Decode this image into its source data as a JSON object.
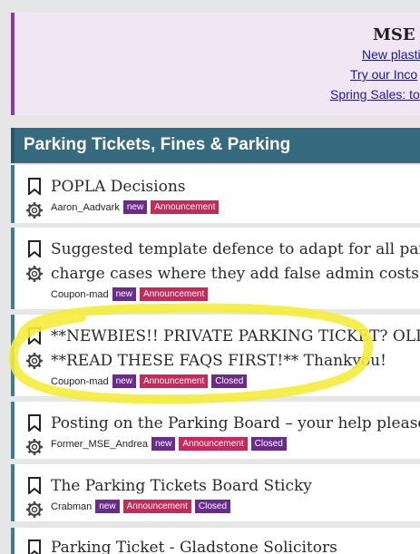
{
  "banner": {
    "title": "MSE H",
    "links": [
      "New plastic #",
      "Try our Inco",
      "Spring Sales: to"
    ]
  },
  "board": {
    "title": "Parking Tickets, Fines & Parking"
  },
  "threads": [
    {
      "title_lines": [
        "POPLA Decisions"
      ],
      "author": "Aaron_Aadvark",
      "badges": [
        "new",
        "Announcement"
      ]
    },
    {
      "title_lines": [
        "Suggested template defence to adapt for all parki",
        "charge cases where they add false admin costs"
      ],
      "author": "Coupon-mad",
      "badges": [
        "new",
        "Announcement"
      ]
    },
    {
      "title_lines": [
        "**NEWBIES!! PRIVATE PARKING TICKET? OLD C",
        "**READ THESE FAQS FIRST!** Thankyou!"
      ],
      "author": "Coupon-mad",
      "badges": [
        "new",
        "Announcement",
        "Closed"
      ]
    },
    {
      "title_lines": [
        "Posting on the Parking Board – your help please"
      ],
      "author": "Former_MSE_Andrea",
      "badges": [
        "new",
        "Announcement",
        "Closed"
      ]
    },
    {
      "title_lines": [
        "The Parking Tickets Board Sticky"
      ],
      "author": "Crabman",
      "badges": [
        "new",
        "Announcement",
        "Closed"
      ]
    },
    {
      "title_lines": [
        "Parking Ticket - Gladstone Solicitors"
      ],
      "author": "",
      "badges": []
    }
  ],
  "colors": {
    "header_bg": "#356a7f",
    "badge_new": "#6a2a8e",
    "badge_announcement": "#c8285a",
    "badge_closed": "#6a2a8e",
    "highlight": "#f5ec3a"
  },
  "icons": [
    "bookmark-icon",
    "gear-icon"
  ]
}
